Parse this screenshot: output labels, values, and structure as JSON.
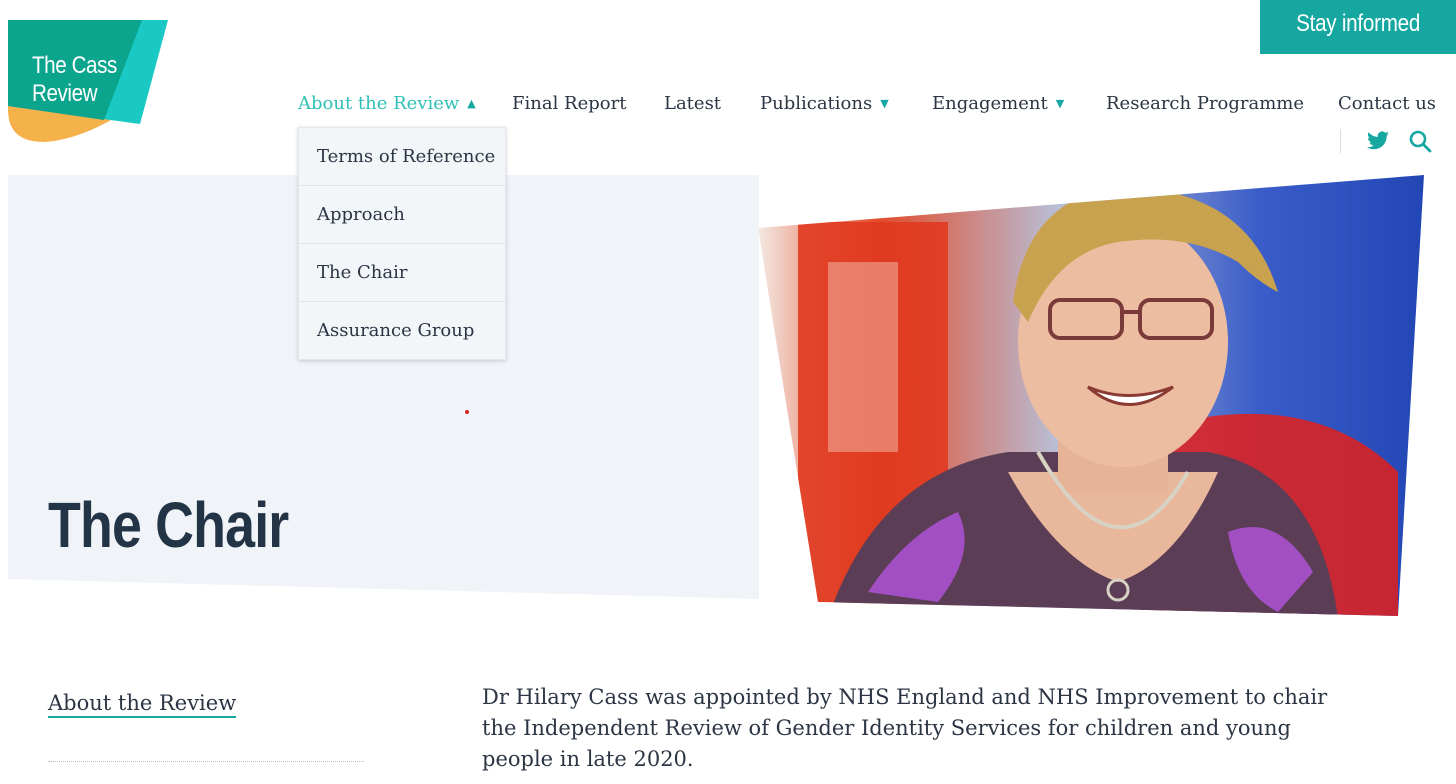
{
  "logo": {
    "line1": "The Cass",
    "line2": "Review"
  },
  "header": {
    "cta_label": "Stay informed"
  },
  "nav": {
    "items": [
      {
        "label": "About the Review",
        "has_caret": true,
        "active": true
      },
      {
        "label": "Final Report"
      },
      {
        "label": "Latest"
      },
      {
        "label": "Publications",
        "has_caret": true
      },
      {
        "label": "Engagement",
        "has_caret": true
      },
      {
        "label": "Research Programme"
      },
      {
        "label": "Contact us"
      }
    ],
    "icons": [
      "twitter-icon",
      "search-icon"
    ],
    "caret_up": "▲",
    "caret_down": "▼"
  },
  "dropdown": {
    "items": [
      "Terms of Reference",
      "Approach",
      "The Chair",
      "Assurance Group"
    ]
  },
  "hero": {
    "title": "The Chair"
  },
  "sidebar": {
    "link": "About the Review"
  },
  "main": {
    "intro": "Dr Hilary Cass was appointed by NHS England and NHS Improvement to chair the Independent Review of Gender Identity Services for children and young people in late 2020."
  },
  "colors": {
    "accent": "#15a7a0",
    "active_nav": "#2fc0b5",
    "logo_green": "#0aa58c",
    "logo_teal": "#1ac9c4",
    "logo_orange": "#f6b24a",
    "text": "#2b3544",
    "hero_panel": "#f0f4f8"
  }
}
